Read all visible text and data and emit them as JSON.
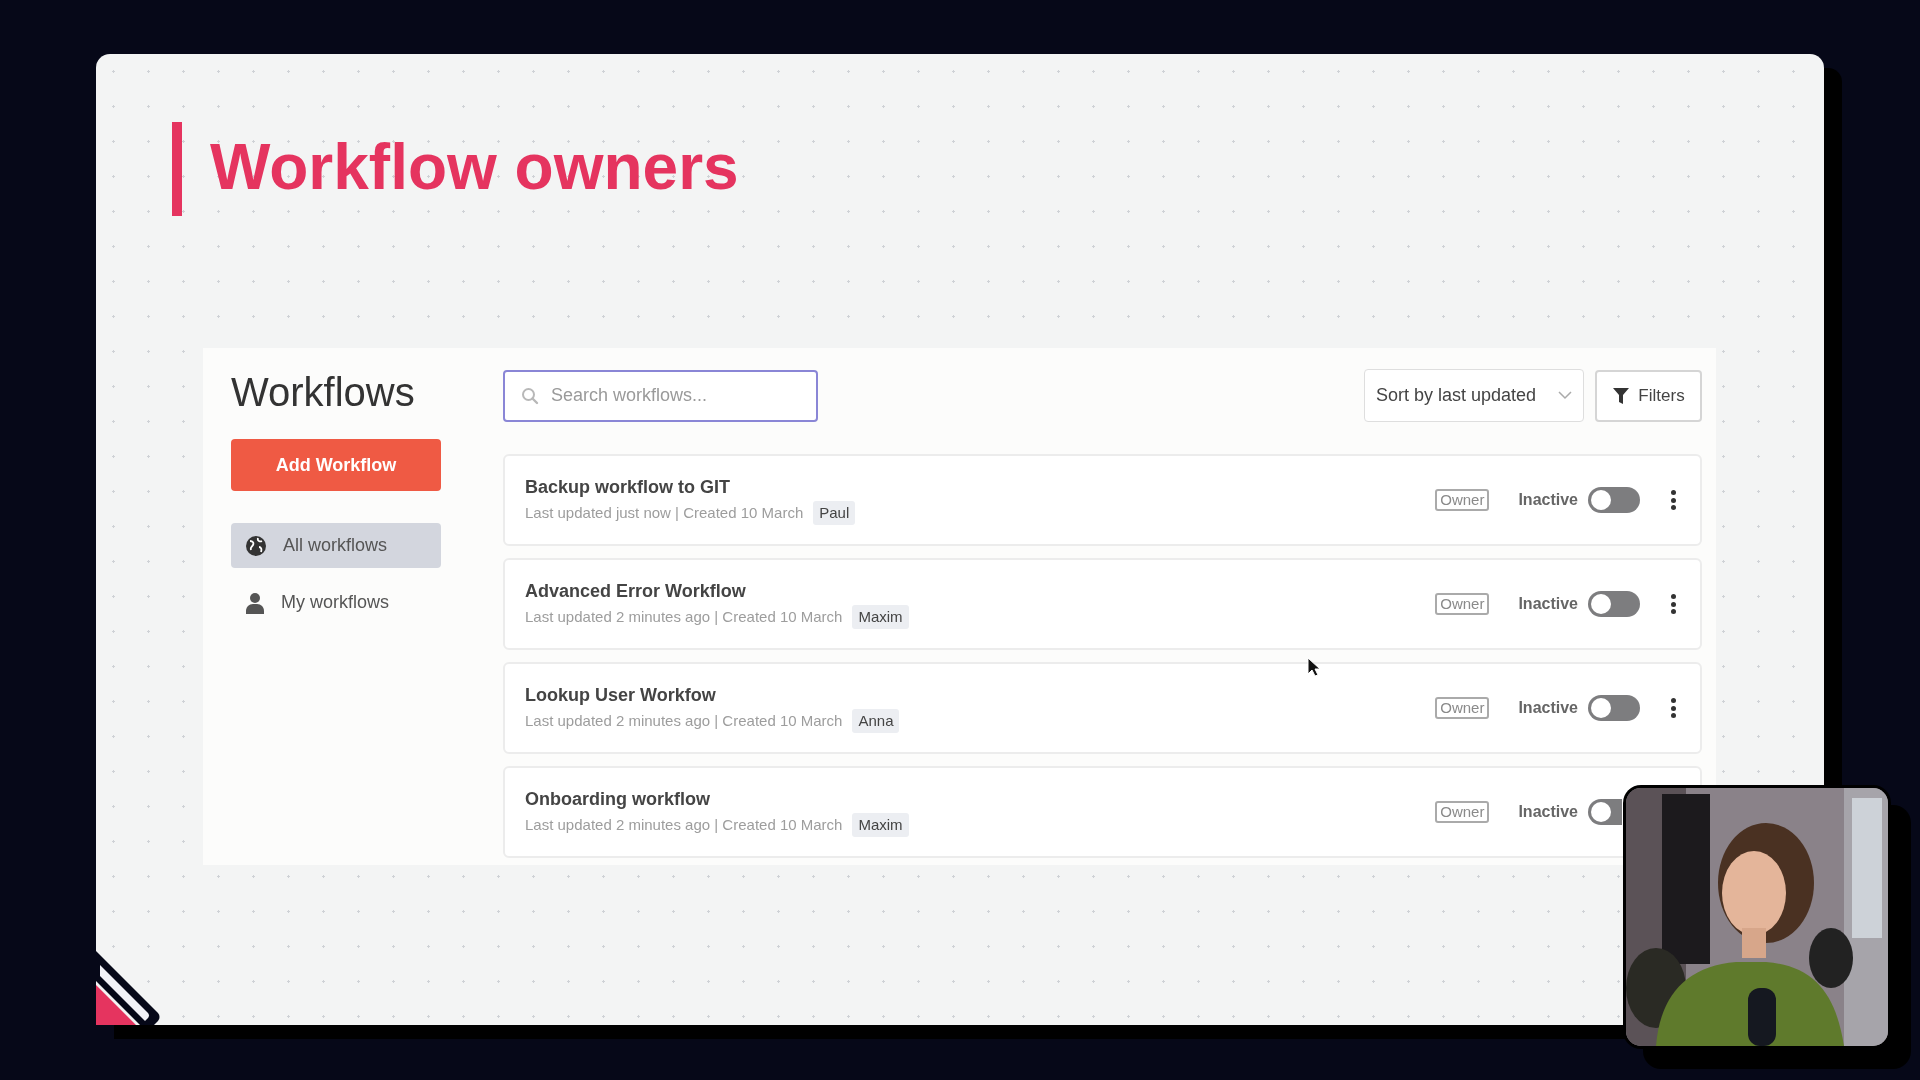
{
  "slide": {
    "title": "Workflow owners"
  },
  "app": {
    "heading": "Workflows",
    "add_button": "Add Workflow",
    "nav": [
      {
        "label": "All workflows",
        "selected": true
      },
      {
        "label": "My workflows",
        "selected": false
      }
    ],
    "search": {
      "placeholder": "Search workflows..."
    },
    "sort": "Sort by last updated",
    "filters": "Filters",
    "rows": [
      {
        "title": "Backup workflow to GIT",
        "meta": "Last updated just now | Created 10 March",
        "owner_name": "Paul",
        "role": "Owner",
        "status": "Inactive",
        "on": false,
        "menu": true
      },
      {
        "title": "Advanced Error Workflow",
        "meta": "Last updated 2 minutes ago | Created 10 March",
        "owner_name": "Maxim",
        "role": "Owner",
        "status": "Inactive",
        "on": false,
        "menu": true
      },
      {
        "title": "Lookup User Workfow",
        "meta": "Last updated 2 minutes ago | Created 10 March",
        "owner_name": "Anna",
        "role": "Owner",
        "status": "Inactive",
        "on": false,
        "menu": true
      },
      {
        "title": "Onboarding workflow",
        "meta": "Last updated 2 minutes ago | Created 10 March",
        "owner_name": "Maxim",
        "role": "Owner",
        "status": "Inactive",
        "on": false,
        "menu": false
      }
    ]
  }
}
